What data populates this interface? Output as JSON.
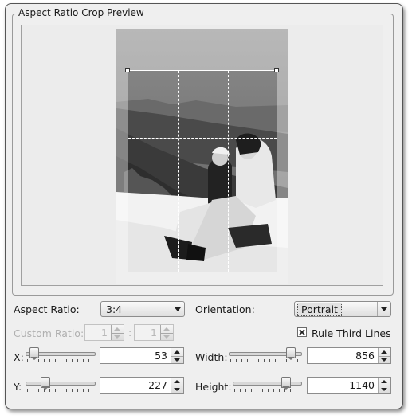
{
  "group_title": "Aspect Ratio Crop Preview",
  "preview": {
    "rule_third_lines_visible": true
  },
  "controls": {
    "aspect_ratio": {
      "label": "Aspect Ratio:",
      "value": "3:4"
    },
    "orientation": {
      "label": "Orientation:",
      "value": "Portrait"
    },
    "custom_ratio": {
      "label": "Custom Ratio:",
      "numerator": "1",
      "separator": ":",
      "denominator": "1"
    },
    "rule_third_lines": {
      "label": "Rule Third Lines",
      "checked": true
    },
    "x": {
      "label": "X:",
      "value": "53"
    },
    "y": {
      "label": "Y:",
      "value": "227"
    },
    "width": {
      "label": "Width:",
      "value": "856"
    },
    "height": {
      "label": "Height:",
      "value": "1140"
    }
  },
  "colors": {
    "window_bg": "#efefef",
    "photo_sky": "#8a8a8a",
    "snow": "#f4f4f4"
  }
}
